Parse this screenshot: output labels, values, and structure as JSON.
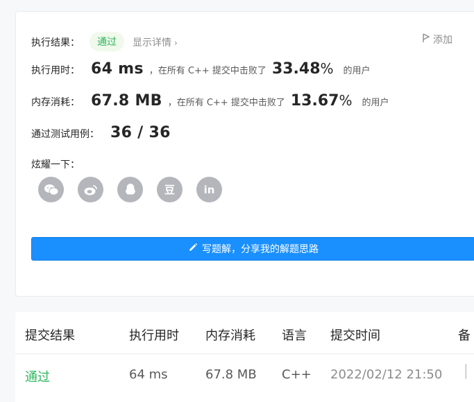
{
  "result": {
    "label": "执行结果：",
    "status": "通过",
    "details": "显示详情",
    "details_chevron": "›",
    "add_to": "添加"
  },
  "runtime": {
    "label": "执行用时：",
    "value": "64 ms",
    "text": "，在所有 C++ 提交中击败了",
    "percent": "33.48",
    "percent_sign": "%",
    "suffix": "的用户"
  },
  "memory": {
    "label": "内存消耗：",
    "value": "67.8 MB",
    "text": "，在所有 C++ 提交中击败了",
    "percent": "13.67",
    "percent_sign": "%",
    "suffix": "的用户"
  },
  "testcases": {
    "label": "通过测试用例：",
    "value": "36 / 36"
  },
  "share": {
    "label": "炫耀一下：",
    "icons": [
      "wechat-icon",
      "weibo-icon",
      "qq-icon",
      "douban-icon",
      "linkedin-icon"
    ],
    "douban_glyph": "豆",
    "linkedin_glyph": "in"
  },
  "write_button": {
    "label": "写题解，分享我的解题思路"
  },
  "table": {
    "headers": [
      "提交结果",
      "执行用时",
      "内存消耗",
      "语言",
      "提交时间",
      "备"
    ],
    "rows": [
      {
        "result": "通过",
        "runtime": "64 ms",
        "memory": "67.8 MB",
        "language": "C++",
        "time": "2022/02/12 21:50"
      }
    ]
  },
  "colors": {
    "accent": "#1a90ff",
    "success": "#2db55d"
  }
}
